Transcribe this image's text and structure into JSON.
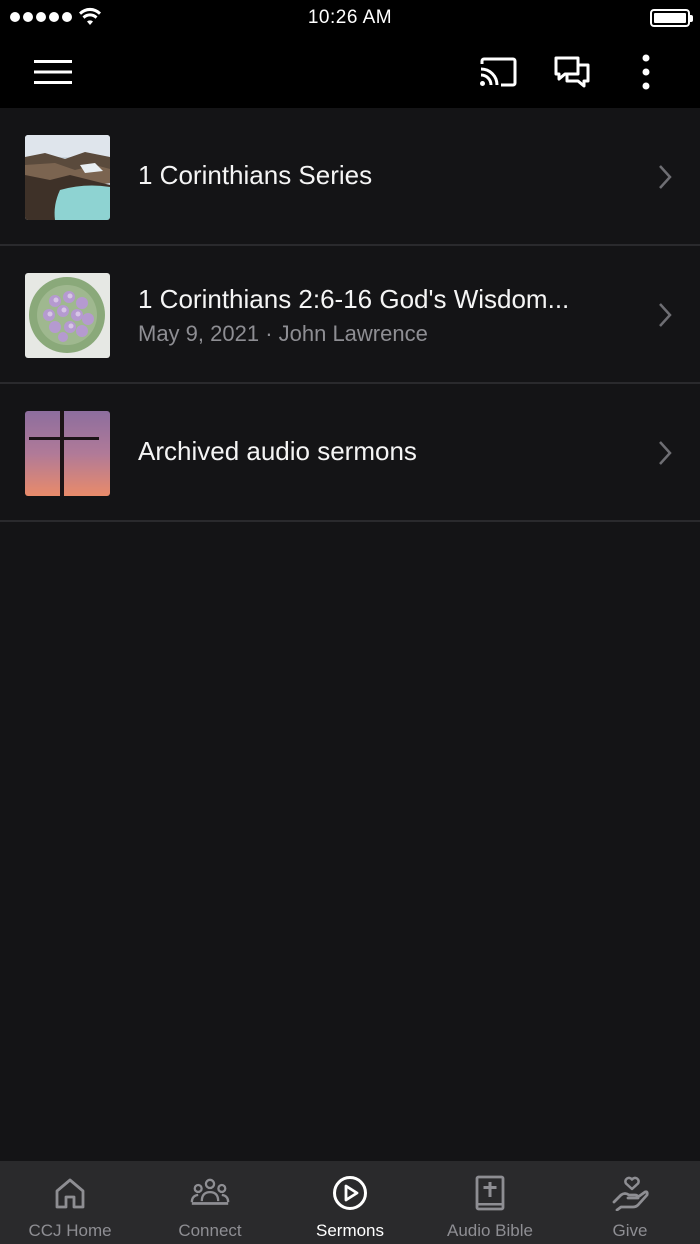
{
  "status_bar": {
    "time": "10:26 AM"
  },
  "toolbar": {
    "menu_icon": "hamburger-menu-icon",
    "cast_icon": "cast-icon",
    "chat_icon": "chat-bubbles-icon",
    "more_icon": "more-vertical-icon"
  },
  "list": {
    "items": [
      {
        "title": "1 Corinthians Series",
        "subtitle": "",
        "thumb": "landscape-lake-thumbnail"
      },
      {
        "title": "1 Corinthians 2:6-16   God's Wisdom...",
        "subtitle": "May 9, 2021 · John Lawrence",
        "thumb": "purple-flowers-thumbnail"
      },
      {
        "title": "Archived audio sermons",
        "subtitle": "",
        "thumb": "cross-sunset-thumbnail"
      }
    ]
  },
  "tabbar": {
    "tabs": [
      {
        "label": "CCJ Home",
        "icon": "home-icon",
        "active": false
      },
      {
        "label": "Connect",
        "icon": "people-icon",
        "active": false
      },
      {
        "label": "Sermons",
        "icon": "play-circle-icon",
        "active": true
      },
      {
        "label": "Audio Bible",
        "icon": "bible-icon",
        "active": false
      },
      {
        "label": "Give",
        "icon": "heart-hand-icon",
        "active": false
      }
    ]
  },
  "colors": {
    "background": "#141416",
    "toolbar": "#000000",
    "tabbar": "#2a2a2c",
    "active_tab": "#ffffff",
    "inactive_tab": "#8e8e93"
  }
}
